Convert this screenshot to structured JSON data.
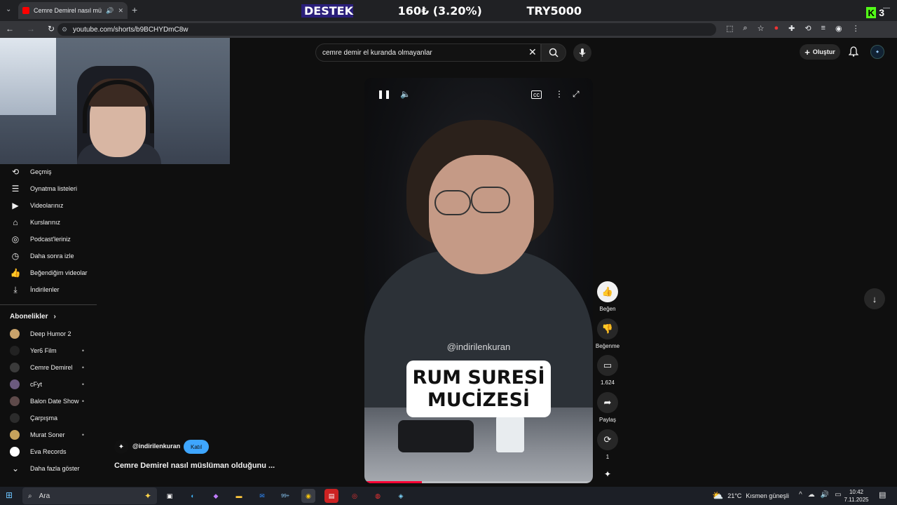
{
  "browser": {
    "tab_title": "Cemre Demirel nasıl müslü...",
    "url": "youtube.com/shorts/b9BCHYDmC8w"
  },
  "stream_overlay": {
    "label": "DESTEK",
    "amount": "160₺ (3.20%)",
    "goal": "TRY5000",
    "kick_count": "3"
  },
  "youtube": {
    "search_query": "cemre demir el kuranda olmayanlar",
    "create_label": "Oluştur"
  },
  "sidebar": {
    "items": [
      {
        "label": "Geçmiş",
        "icon": "history-icon"
      },
      {
        "label": "Oynatma listeleri",
        "icon": "playlist-icon"
      },
      {
        "label": "Videolarınız",
        "icon": "your-videos-icon"
      },
      {
        "label": "Kurslarınız",
        "icon": "courses-icon"
      },
      {
        "label": "Podcast'leriniz",
        "icon": "podcast-icon"
      },
      {
        "label": "Daha sonra izle",
        "icon": "watch-later-icon"
      },
      {
        "label": "Beğendiğim videolar",
        "icon": "liked-icon"
      },
      {
        "label": "İndirilenler",
        "icon": "download-icon"
      }
    ],
    "subscriptions_heading": "Abonelikler",
    "subscriptions": [
      {
        "label": "Deep Humor 2",
        "color": "#c9a36b"
      },
      {
        "label": "Yer6 Film",
        "color": "#222222"
      },
      {
        "label": "Cemre Demirel",
        "color": "#3b3b3b"
      },
      {
        "label": "cFyt",
        "color": "#6b5a7e"
      },
      {
        "label": "Balon Date Show",
        "color": "#5e4a4a"
      },
      {
        "label": "Çarpışma",
        "color": "#2c2c2c"
      },
      {
        "label": "Murat Soner",
        "color": "#c7a35c"
      },
      {
        "label": "Eva Records",
        "color": "#ffffff"
      }
    ],
    "show_more": "Daha fazla göster"
  },
  "video": {
    "watermark": "@indirilenkuran",
    "caption_line1": "RUM SURESİ",
    "caption_line2": "MUCİZESİ",
    "progress": 0.25,
    "channel": "@indirilenkuran",
    "join": "Katıl",
    "title": "Cemre Demirel nasıl müslüman olduğunu ..."
  },
  "actions": {
    "like": "Beğen",
    "dislike": "Beğenme",
    "comments": "1.624",
    "share": "Paylaş",
    "remix": "1"
  },
  "taskbar": {
    "search_placeholder": "Ara",
    "weather_temp": "21°C",
    "weather_desc": "Kısmen güneşli",
    "time": "10:42",
    "date": "7.11.2025",
    "outlook_badge": "99+"
  }
}
